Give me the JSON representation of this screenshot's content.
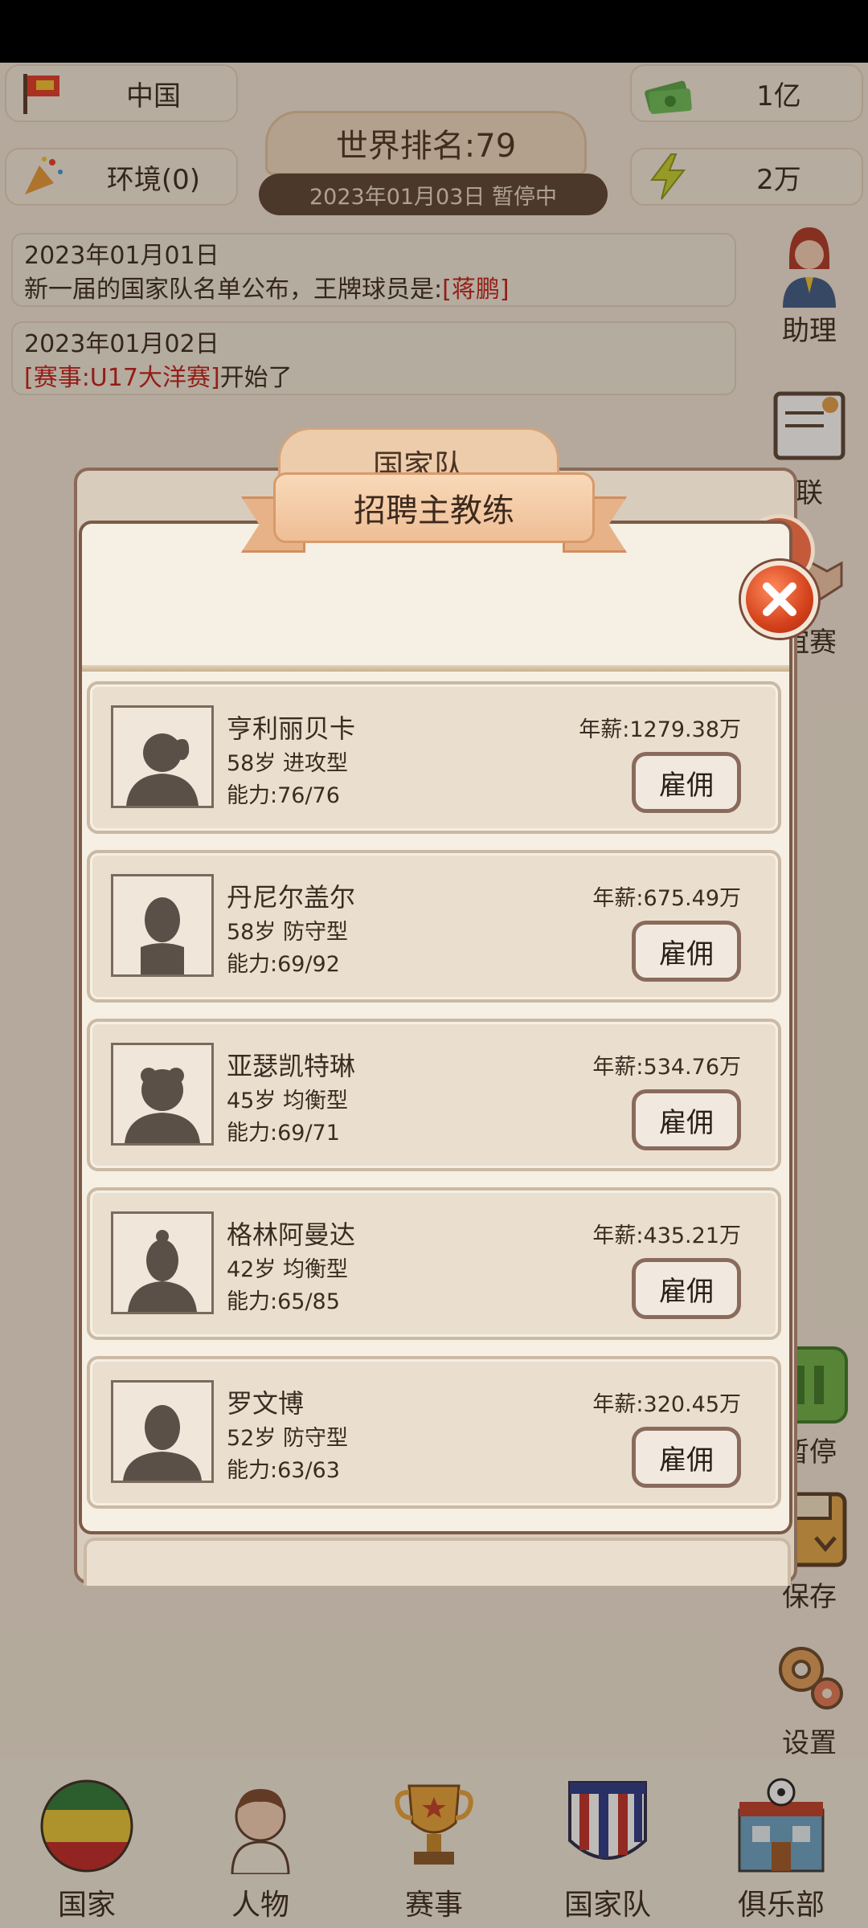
{
  "top": {
    "country": "中国",
    "environment": "环境(0)",
    "rank": "世界排名:79",
    "status_date": "2023年01月03日 暂停中",
    "money": "1亿",
    "energy": "2万"
  },
  "news": [
    {
      "date": "2023年01月01日",
      "text": "新一届的国家队名单公布，王牌球员是:",
      "highlight": "[蒋鹏]"
    },
    {
      "date": "2023年01月02日",
      "highlight": "[赛事:U17大洋赛]",
      "text": "开始了"
    }
  ],
  "side": {
    "assistant": "助理",
    "league": "联",
    "friendly": "谊赛",
    "pause": "暂停",
    "save": "保存",
    "settings": "设置"
  },
  "back_dialog_title": "国家队",
  "dialog": {
    "title": "招聘主教练",
    "hire_label": "雇佣",
    "coaches": [
      {
        "name": "亨利丽贝卡",
        "meta": "58岁 进攻型",
        "ability": "能力:76/76",
        "salary": "年薪:1279.38万"
      },
      {
        "name": "丹尼尔盖尔",
        "meta": "58岁 防守型",
        "ability": "能力:69/92",
        "salary": "年薪:675.49万"
      },
      {
        "name": "亚瑟凯特琳",
        "meta": "45岁 均衡型",
        "ability": "能力:69/71",
        "salary": "年薪:534.76万"
      },
      {
        "name": "格林阿曼达",
        "meta": "42岁 均衡型",
        "ability": "能力:65/85",
        "salary": "年薪:435.21万"
      },
      {
        "name": "罗文博",
        "meta": "52岁 防守型",
        "ability": "能力:63/63",
        "salary": "年薪:320.45万"
      }
    ]
  },
  "nav": [
    "国家",
    "人物",
    "赛事",
    "国家队",
    "俱乐部"
  ],
  "colors": {
    "accent_red": "#c2201a",
    "frame_brown": "#7c5a48",
    "card_bg": "#eadfce"
  }
}
